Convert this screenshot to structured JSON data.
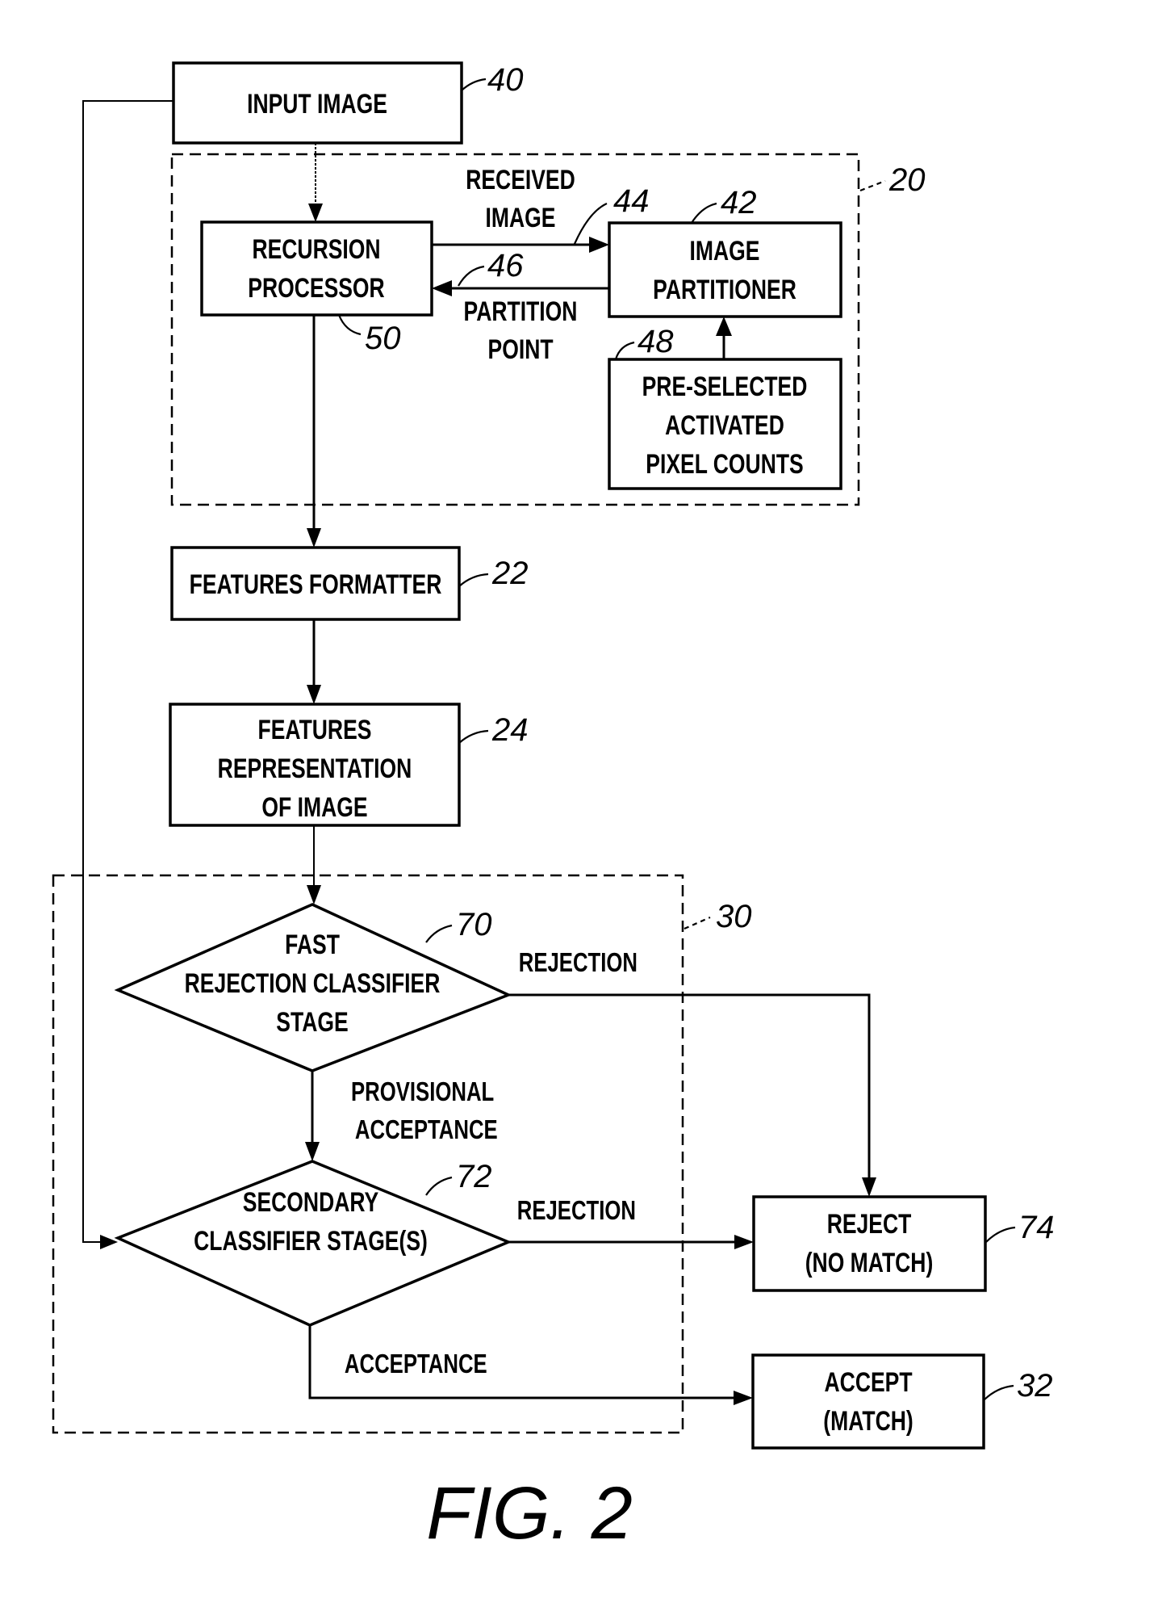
{
  "figure": {
    "caption": "FIG. 2",
    "nodes": {
      "input_image": {
        "ref": "40",
        "lines": [
          "INPUT IMAGE"
        ]
      },
      "recursion_processor": {
        "ref": "50",
        "lines": [
          "RECURSION",
          "PROCESSOR"
        ]
      },
      "image_partitioner": {
        "ref": "42",
        "lines": [
          "IMAGE",
          "PARTITIONER"
        ]
      },
      "preselected_counts": {
        "ref": "48",
        "lines": [
          "PRE-SELECTED",
          "ACTIVATED",
          "PIXEL COUNTS"
        ]
      },
      "features_formatter": {
        "ref": "22",
        "lines": [
          "FEATURES FORMATTER"
        ]
      },
      "features_representation": {
        "ref": "24",
        "lines": [
          "FEATURES",
          "REPRESENTATION",
          "OF IMAGE"
        ]
      },
      "fast_rejection_stage": {
        "ref": "70",
        "lines": [
          "FAST",
          "REJECTION CLASSIFIER",
          "STAGE"
        ]
      },
      "secondary_stage": {
        "ref": "72",
        "lines": [
          "SECONDARY",
          "CLASSIFIER STAGE(S)"
        ]
      },
      "reject": {
        "ref": "74",
        "lines": [
          "REJECT",
          "(NO MATCH)"
        ]
      },
      "accept": {
        "ref": "32",
        "lines": [
          "ACCEPT",
          "(MATCH)"
        ]
      }
    },
    "groups": {
      "recursive_partitioner": {
        "ref": "20"
      },
      "classifier_cascade": {
        "ref": "30"
      }
    },
    "edges": {
      "received_image": {
        "ref": "44",
        "lines": [
          "RECEIVED",
          "IMAGE"
        ]
      },
      "partition_point": {
        "ref": "46",
        "lines": [
          "PARTITION",
          "POINT"
        ]
      },
      "fast_rejection": {
        "label": "REJECTION"
      },
      "provisional_acceptance": {
        "lines": [
          "PROVISIONAL",
          "ACCEPTANCE"
        ]
      },
      "secondary_rejection": {
        "label": "REJECTION"
      },
      "acceptance": {
        "label": "ACCEPTANCE"
      }
    }
  }
}
